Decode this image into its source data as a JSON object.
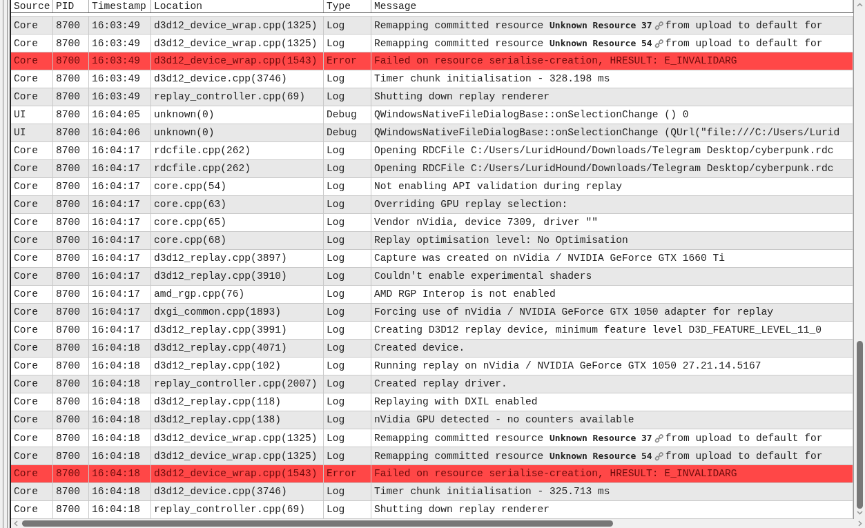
{
  "columns": [
    "Source",
    "PID",
    "Timestamp",
    "Location",
    "Type",
    "Message"
  ],
  "rows": [
    {
      "source": "Core",
      "pid": "8700",
      "timestamp": "16:03:49",
      "location": "d3d12_device_wrap.cpp(1325)",
      "type": "Log",
      "kind": "normal",
      "message": "Remapping committed resource **Unknown Resource 37**",
      "message_tail": "from upload to default for"
    },
    {
      "source": "Core",
      "pid": "8700",
      "timestamp": "16:03:49",
      "location": "d3d12_device_wrap.cpp(1325)",
      "type": "Log",
      "kind": "normal",
      "message": "Remapping committed resource **Unknown Resource 54**",
      "message_tail": "from upload to default for"
    },
    {
      "source": "Core",
      "pid": "8700",
      "timestamp": "16:03:49",
      "location": "d3d12_device_wrap.cpp(1543)",
      "type": "Error",
      "kind": "error",
      "message": "Failed on resource serialise-creation, HRESULT: E_INVALIDARG"
    },
    {
      "source": "Core",
      "pid": "8700",
      "timestamp": "16:03:49",
      "location": "d3d12_device.cpp(3746)",
      "type": "Log",
      "kind": "normal",
      "message": "Timer chunk initialisation - 328.198 ms"
    },
    {
      "source": "Core",
      "pid": "8700",
      "timestamp": "16:03:49",
      "location": "replay_controller.cpp(69)",
      "type": "Log",
      "kind": "normal",
      "message": "Shutting down replay renderer"
    },
    {
      "source": "UI",
      "pid": "8700",
      "timestamp": "16:04:05",
      "location": "unknown(0)",
      "type": "Debug",
      "kind": "normal",
      "message": "QWindowsNativeFileDialogBase::onSelectionChange () 0"
    },
    {
      "source": "UI",
      "pid": "8700",
      "timestamp": "16:04:06",
      "location": "unknown(0)",
      "type": "Debug",
      "kind": "normal",
      "message": "QWindowsNativeFileDialogBase::onSelectionChange (QUrl(\"file:///C:/Users/Lurid"
    },
    {
      "source": "Core",
      "pid": "8700",
      "timestamp": "16:04:17",
      "location": "rdcfile.cpp(262)",
      "type": "Log",
      "kind": "normal",
      "message": "Opening RDCFile C:/Users/LuridHound/Downloads/Telegram Desktop/cyberpunk.rdc"
    },
    {
      "source": "Core",
      "pid": "8700",
      "timestamp": "16:04:17",
      "location": "rdcfile.cpp(262)",
      "type": "Log",
      "kind": "normal",
      "message": "Opening RDCFile C:/Users/LuridHound/Downloads/Telegram Desktop/cyberpunk.rdc"
    },
    {
      "source": "Core",
      "pid": "8700",
      "timestamp": "16:04:17",
      "location": "core.cpp(54)",
      "type": "Log",
      "kind": "normal",
      "message": "Not enabling API validation during replay"
    },
    {
      "source": "Core",
      "pid": "8700",
      "timestamp": "16:04:17",
      "location": "core.cpp(63)",
      "type": "Log",
      "kind": "normal",
      "message": "Overriding GPU replay selection:"
    },
    {
      "source": "Core",
      "pid": "8700",
      "timestamp": "16:04:17",
      "location": "core.cpp(65)",
      "type": "Log",
      "kind": "normal",
      "message": "Vendor nVidia, device 7309, driver \"\""
    },
    {
      "source": "Core",
      "pid": "8700",
      "timestamp": "16:04:17",
      "location": "core.cpp(68)",
      "type": "Log",
      "kind": "normal",
      "message": "Replay optimisation level: No Optimisation"
    },
    {
      "source": "Core",
      "pid": "8700",
      "timestamp": "16:04:17",
      "location": "d3d12_replay.cpp(3897)",
      "type": "Log",
      "kind": "normal",
      "message": "Capture was created on nVidia / NVIDIA GeForce GTX 1660 Ti"
    },
    {
      "source": "Core",
      "pid": "8700",
      "timestamp": "16:04:17",
      "location": "d3d12_replay.cpp(3910)",
      "type": "Log",
      "kind": "normal",
      "message": "Couldn't enable experimental shaders"
    },
    {
      "source": "Core",
      "pid": "8700",
      "timestamp": "16:04:17",
      "location": "amd_rgp.cpp(76)",
      "type": "Log",
      "kind": "normal",
      "message": "AMD RGP Interop is not enabled"
    },
    {
      "source": "Core",
      "pid": "8700",
      "timestamp": "16:04:17",
      "location": "dxgi_common.cpp(1893)",
      "type": "Log",
      "kind": "normal",
      "message": "Forcing use of nVidia / NVIDIA GeForce GTX 1050 adapter for replay"
    },
    {
      "source": "Core",
      "pid": "8700",
      "timestamp": "16:04:17",
      "location": "d3d12_replay.cpp(3991)",
      "type": "Log",
      "kind": "normal",
      "message": "Creating D3D12 replay device, minimum feature level D3D_FEATURE_LEVEL_11_0"
    },
    {
      "source": "Core",
      "pid": "8700",
      "timestamp": "16:04:18",
      "location": "d3d12_replay.cpp(4071)",
      "type": "Log",
      "kind": "normal",
      "message": "Created device."
    },
    {
      "source": "Core",
      "pid": "8700",
      "timestamp": "16:04:18",
      "location": "d3d12_replay.cpp(102)",
      "type": "Log",
      "kind": "normal",
      "message": "Running replay on nVidia / NVIDIA GeForce GTX 1050 27.21.14.5167"
    },
    {
      "source": "Core",
      "pid": "8700",
      "timestamp": "16:04:18",
      "location": "replay_controller.cpp(2007)",
      "type": "Log",
      "kind": "normal",
      "message": "Created replay driver."
    },
    {
      "source": "Core",
      "pid": "8700",
      "timestamp": "16:04:18",
      "location": "d3d12_replay.cpp(118)",
      "type": "Log",
      "kind": "normal",
      "message": "Replaying with DXIL enabled"
    },
    {
      "source": "Core",
      "pid": "8700",
      "timestamp": "16:04:18",
      "location": "d3d12_replay.cpp(138)",
      "type": "Log",
      "kind": "normal",
      "message": "nVidia GPU detected - no counters available"
    },
    {
      "source": "Core",
      "pid": "8700",
      "timestamp": "16:04:18",
      "location": "d3d12_device_wrap.cpp(1325)",
      "type": "Log",
      "kind": "normal",
      "message": "Remapping committed resource **Unknown Resource 37**",
      "message_tail": "from upload to default for"
    },
    {
      "source": "Core",
      "pid": "8700",
      "timestamp": "16:04:18",
      "location": "d3d12_device_wrap.cpp(1325)",
      "type": "Log",
      "kind": "normal",
      "message": "Remapping committed resource **Unknown Resource 54**",
      "message_tail": "from upload to default for"
    },
    {
      "source": "Core",
      "pid": "8700",
      "timestamp": "16:04:18",
      "location": "d3d12_device_wrap.cpp(1543)",
      "type": "Error",
      "kind": "error",
      "message": "Failed on resource serialise-creation, HRESULT: E_INVALIDARG"
    },
    {
      "source": "Core",
      "pid": "8700",
      "timestamp": "16:04:18",
      "location": "d3d12_device.cpp(3746)",
      "type": "Log",
      "kind": "normal",
      "message": "Timer chunk initialisation - 325.713 ms"
    },
    {
      "source": "Core",
      "pid": "8700",
      "timestamp": "16:04:18",
      "location": "replay_controller.cpp(69)",
      "type": "Log",
      "kind": "normal",
      "message": "Shutting down replay renderer"
    }
  ]
}
